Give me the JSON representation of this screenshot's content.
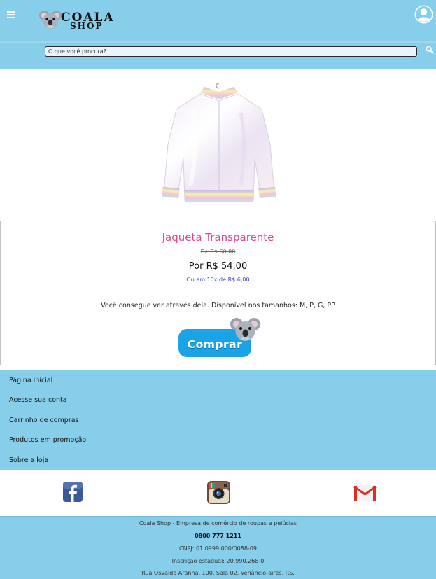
{
  "header": {
    "logo_line1": "COALA",
    "logo_line2": "SHOP",
    "search_placeholder": "O que você procura?"
  },
  "product": {
    "name": "Jaqueta Transparente",
    "old_price": "De R$ 60,00",
    "price": "Por R$ 54,00",
    "installments": "Ou em 10x de R$ 6,00",
    "description": "Você consegue ver através dela. Disponível nos tamanhos: M, P, G, PP",
    "buy_label": "Comprar"
  },
  "nav": {
    "items": [
      {
        "label": "Página inicial"
      },
      {
        "label": "Acesse sua conta"
      },
      {
        "label": "Carrinho de compras"
      },
      {
        "label": "Produtos em promoção"
      },
      {
        "label": "Sobre a loja"
      }
    ]
  },
  "social": {
    "icons": [
      "facebook-icon",
      "instagram-icon",
      "gmail-icon"
    ]
  },
  "footer": {
    "company": "Coala Shop - Empresa de comércio de roupas e pelúcias",
    "phone": "0800 777 1211",
    "cnpj": "CNPJ: 01.0999.000/0088-09",
    "state_registration": "Inscrição estadual: 20.990.268-0",
    "address": "Rua Osvaldo Aranha, 100. Sala 02. Venâncio-aires, RS."
  },
  "colors": {
    "header_bg": "#87ceeb",
    "product_name": "#e0438f",
    "installments": "#3347d8",
    "buy_button": "#1aa3e6"
  }
}
